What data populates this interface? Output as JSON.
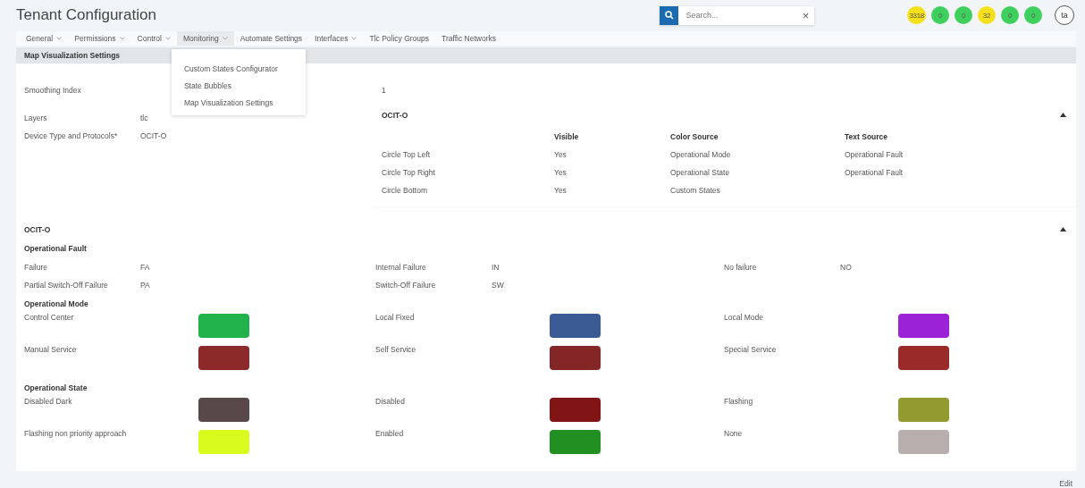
{
  "header": {
    "title": "Tenant Configuration",
    "search": {
      "placeholder": "Search..."
    },
    "clear": "×",
    "badges": [
      {
        "label": "3318",
        "color": "#f5e11b"
      },
      {
        "label": "0",
        "color": "#3fcf5c"
      },
      {
        "label": "0",
        "color": "#3fcf5c"
      },
      {
        "label": "32",
        "color": "#f5e11b"
      },
      {
        "label": "0",
        "color": "#3fcf5c"
      },
      {
        "label": "0",
        "color": "#3fcf5c"
      }
    ],
    "avatar": "ta"
  },
  "nav": [
    {
      "label": "General",
      "dropdown": true,
      "expanded": false
    },
    {
      "label": "Permissions",
      "dropdown": true,
      "expanded": false
    },
    {
      "label": "Control",
      "dropdown": true,
      "expanded": false
    },
    {
      "label": "Monitoring",
      "dropdown": true,
      "expanded": true,
      "menu": [
        "Custom States Configurator",
        "State Bubbles",
        "Map Visualization Settings"
      ]
    },
    {
      "label": "Automate Settings",
      "dropdown": false,
      "expanded": false
    },
    {
      "label": "Interfaces",
      "dropdown": true,
      "expanded": false
    },
    {
      "label": "Tlc Policy Groups",
      "dropdown": false,
      "expanded": false
    },
    {
      "label": "Traffic Networks",
      "dropdown": false,
      "expanded": false
    }
  ],
  "panel": {
    "title": "Map Visualization Settings",
    "smoothing": {
      "label": "Smoothing Index",
      "value": "1"
    },
    "fields": [
      {
        "label": "Layers",
        "value": "tlc"
      },
      {
        "label": "Device Type and Protocols*",
        "value": "OCIT-O"
      }
    ],
    "bubble_card": {
      "title": "OCIT-O",
      "expanded": true,
      "columns": [
        "Visible",
        "Color Source",
        "Text Source"
      ],
      "rows": [
        {
          "name": "Circle Top Left",
          "visible": "Yes",
          "color_source": "Operational Mode",
          "text_source": "Operational Fault"
        },
        {
          "name": "Circle Top Right",
          "visible": "Yes",
          "color_source": "Operational State",
          "text_source": "Operational Fault"
        },
        {
          "name": "Circle Bottom",
          "visible": "Yes",
          "color_source": "Custom States"
        }
      ]
    },
    "section": {
      "title": "OCIT-O",
      "expanded": true,
      "groups": [
        {
          "title": "Operational Fault",
          "kind": "codes",
          "items": [
            {
              "label": "Failure",
              "value": "FA"
            },
            {
              "label": "Internal Failure",
              "value": "IN"
            },
            {
              "label": "No failure",
              "value": "NO"
            },
            {
              "label": "Partial Switch-Off Failure",
              "value": "PA"
            },
            {
              "label": "Switch-Off Failure",
              "value": "SW"
            }
          ]
        },
        {
          "title": "Operational Mode",
          "kind": "colors",
          "items": [
            {
              "label": "Control Center",
              "color": "#22b24c"
            },
            {
              "label": "Local Fixed",
              "color": "#3a5a94"
            },
            {
              "label": "Local Mode",
              "color": "#9b22d6"
            },
            {
              "label": "Manual Service",
              "color": "#8c2a2a"
            },
            {
              "label": "Self Service",
              "color": "#842626"
            },
            {
              "label": "Special Service",
              "color": "#9a2a2a"
            }
          ]
        },
        {
          "title": "Operational State",
          "kind": "colors",
          "items": [
            {
              "label": "Disabled Dark",
              "color": "#584848"
            },
            {
              "label": "Disabled",
              "color": "#811414"
            },
            {
              "label": "Flashing",
              "color": "#939a30"
            },
            {
              "label": "Flashing non priority approach",
              "color": "#d9fb1e"
            },
            {
              "label": "Enabled",
              "color": "#218f22"
            },
            {
              "label": "None",
              "color": "#b8aeae"
            }
          ]
        }
      ]
    }
  },
  "edit": "Edit"
}
